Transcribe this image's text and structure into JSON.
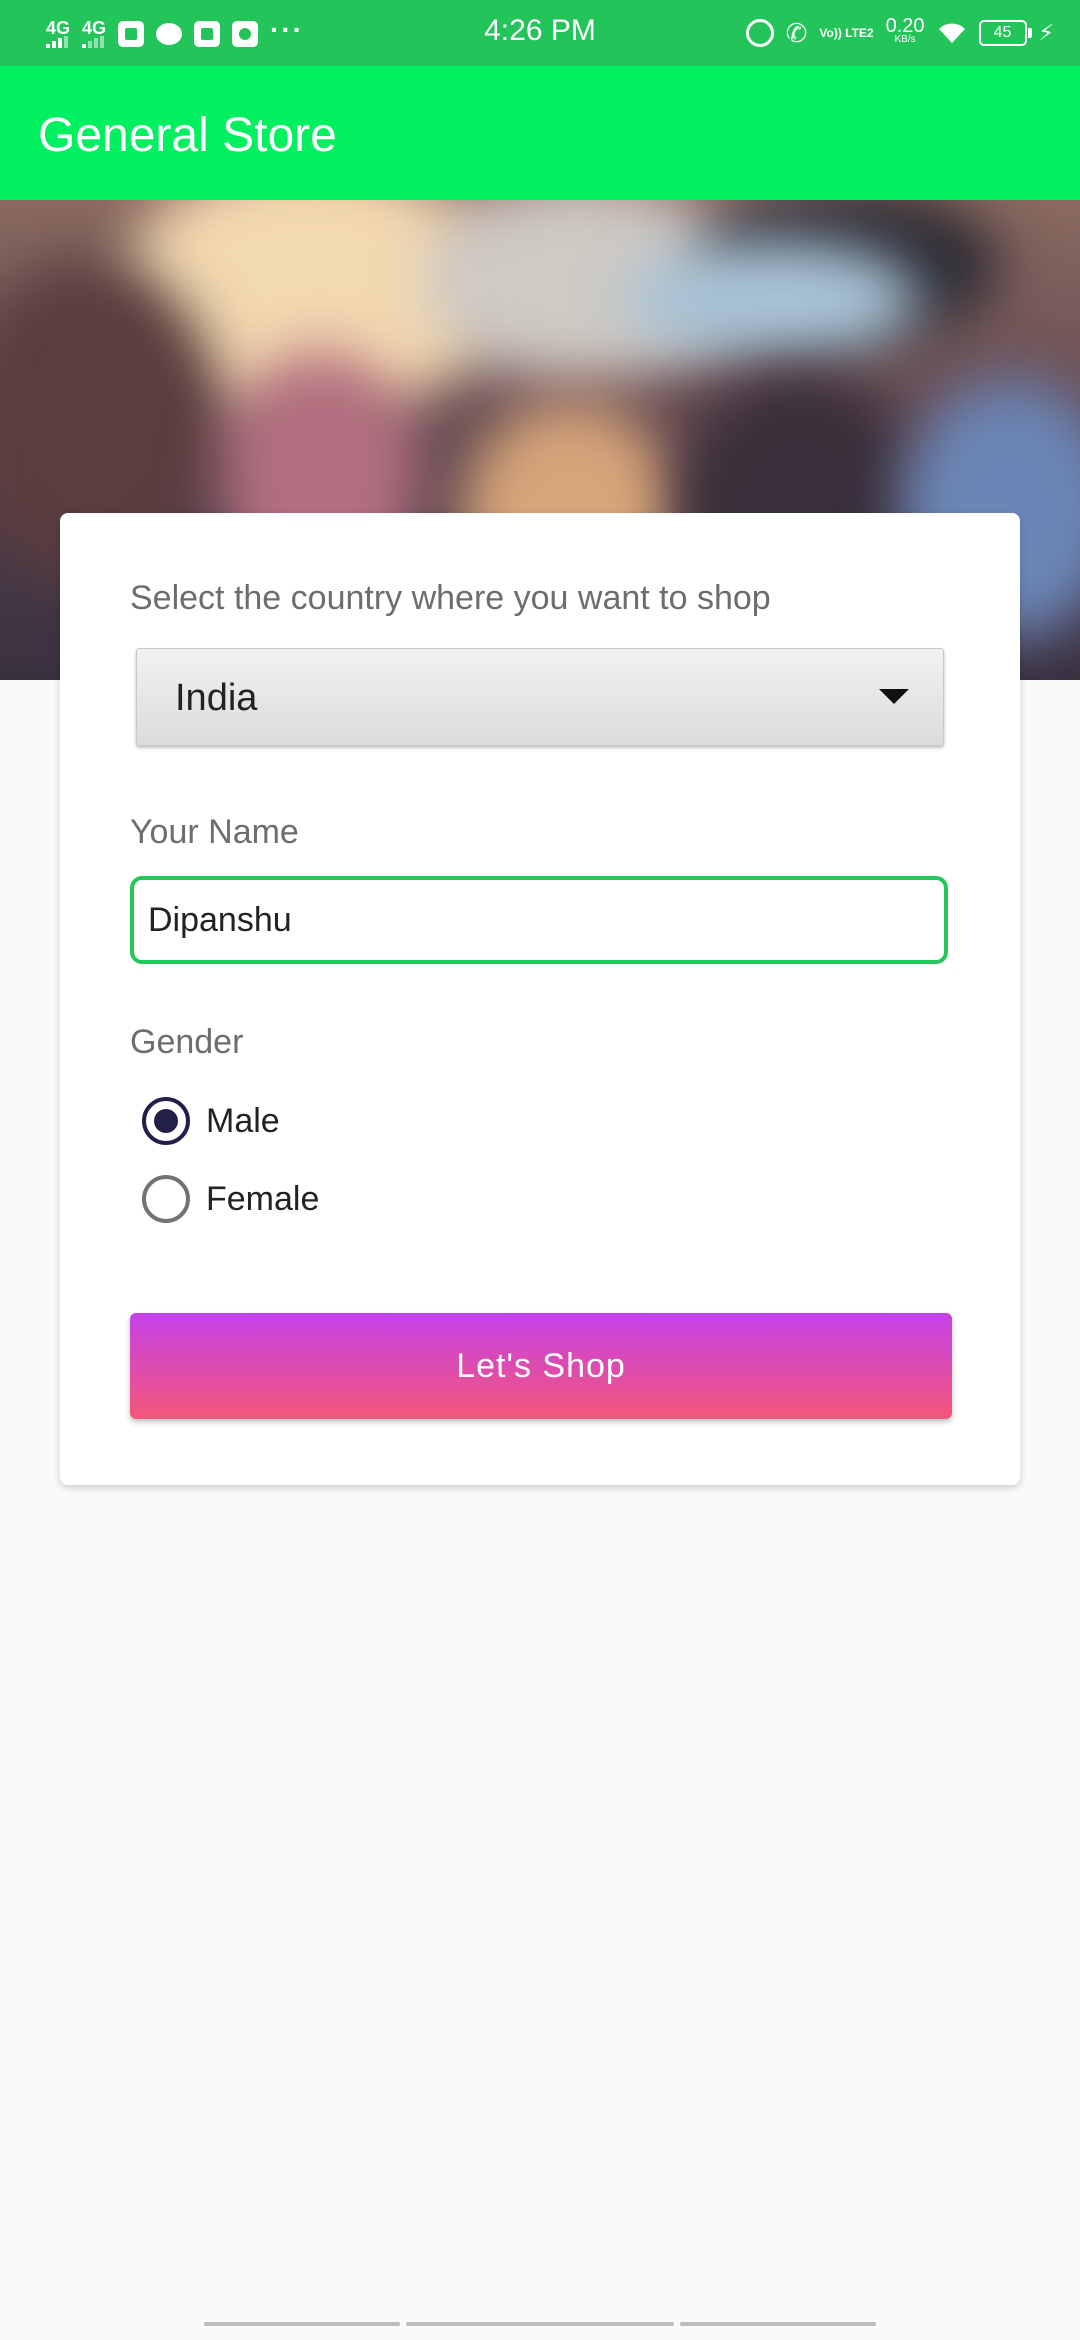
{
  "status_bar": {
    "time": "4:26 PM",
    "network_1": "4G",
    "network_2": "4G",
    "volte": "Vo)) LTE2",
    "speed_value": "0.20",
    "speed_unit": "KB/s",
    "battery": "45",
    "overflow": "···"
  },
  "app_bar": {
    "title": "General Store"
  },
  "form": {
    "country_label": "Select the country where you want to shop",
    "country_selected": "India",
    "name_label": "Your Name",
    "name_value": "Dipanshu",
    "gender_label": "Gender",
    "gender_options": [
      {
        "label": "Male",
        "checked": true
      },
      {
        "label": "Female",
        "checked": false
      }
    ],
    "submit_label": "Let's  Shop"
  },
  "colors": {
    "status_bar": "#23c45a",
    "app_bar": "#00f060",
    "input_border": "#22c95a",
    "button_top": "#c441e8",
    "button_bottom": "#f45779",
    "radio_checked": "#22204a"
  }
}
